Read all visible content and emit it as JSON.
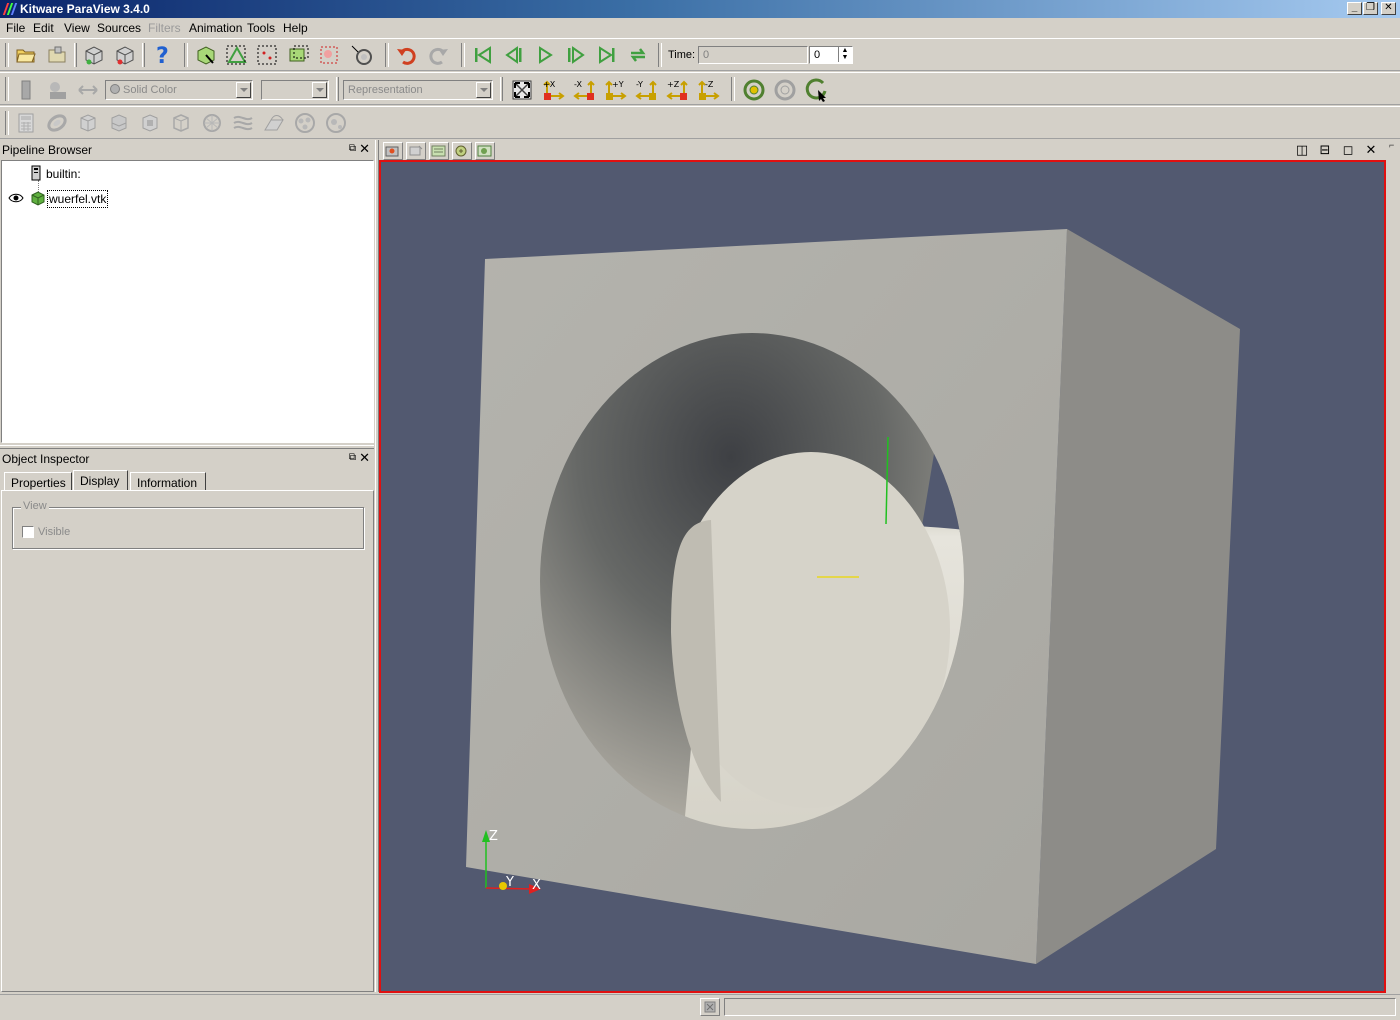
{
  "window": {
    "title": "Kitware ParaView 3.4.0"
  },
  "menu": [
    "File",
    "Edit",
    "View",
    "Sources",
    "Filters",
    "Animation",
    "Tools",
    "Help"
  ],
  "menu_disabled": [
    "Filters"
  ],
  "time": {
    "label": "Time:",
    "value": "0",
    "step": "0"
  },
  "display": {
    "color_by": "Solid Color",
    "component": "",
    "representation": "Representation"
  },
  "axes_buttons": [
    "+X",
    "-X",
    "+Y",
    "-Y",
    "+Z",
    "-Z"
  ],
  "pipeline_browser": {
    "title": "Pipeline Browser",
    "items": [
      {
        "label": "builtin:",
        "icon": "server-icon"
      },
      {
        "label": "wuerfel.vtk",
        "icon": "dataset-cube-icon",
        "visible": true,
        "selected": true
      }
    ]
  },
  "object_inspector": {
    "title": "Object Inspector",
    "tabs": [
      "Properties",
      "Display",
      "Information"
    ],
    "active_tab": "Display",
    "group_title": "View",
    "visible_label": "Visible",
    "visible_checked": false
  },
  "orientation_axes": {
    "x": "X",
    "y": "Y",
    "z": "Z"
  },
  "colors": {
    "background": "#525970",
    "active_border": "#e01010",
    "surface": "#b0aea6"
  }
}
